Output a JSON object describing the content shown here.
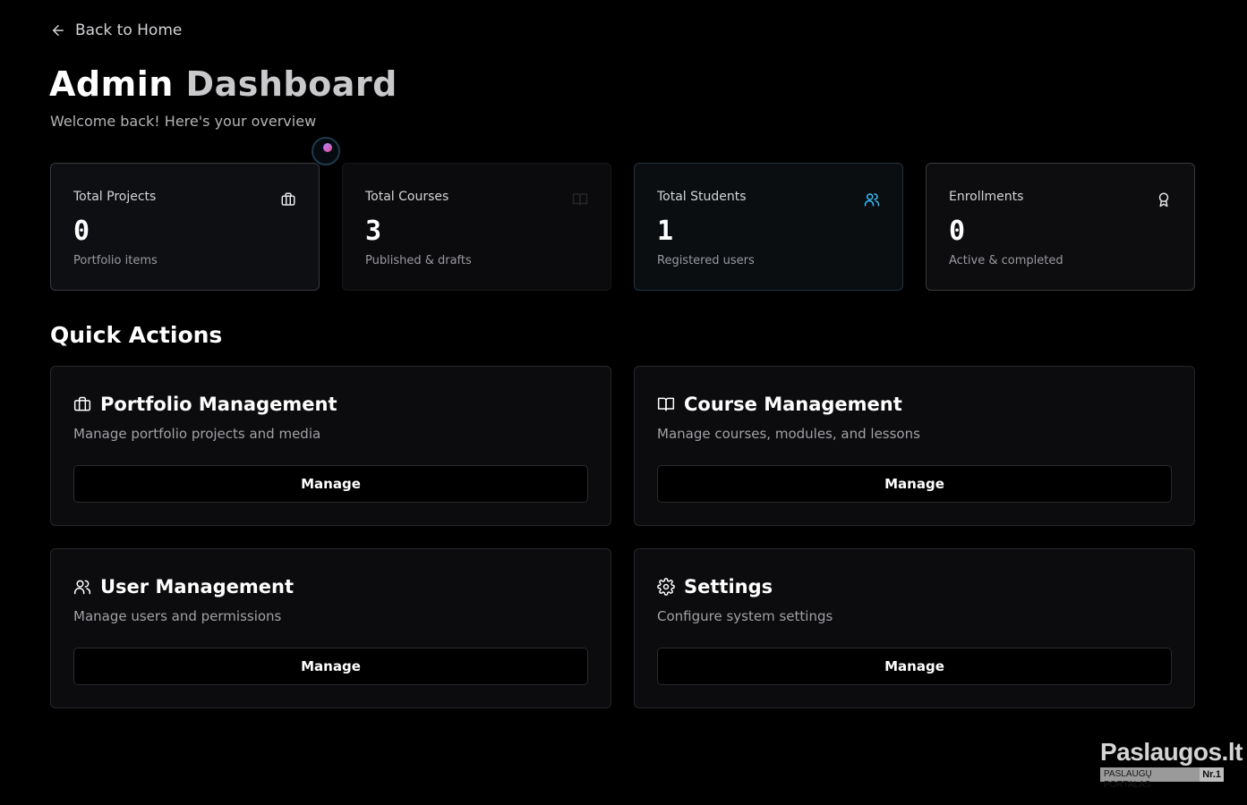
{
  "nav": {
    "back_label": "Back to Home"
  },
  "header": {
    "title_part1": "Admin",
    "title_part2": "Dashboard",
    "subtitle": "Welcome back! Here's your overview"
  },
  "stats": [
    {
      "label": "Total Projects",
      "value": "0",
      "desc": "Portfolio items",
      "icon": "briefcase-icon"
    },
    {
      "label": "Total Courses",
      "value": "3",
      "desc": "Published & drafts",
      "icon": "book-icon"
    },
    {
      "label": "Total Students",
      "value": "1",
      "desc": "Registered users",
      "icon": "users-icon"
    },
    {
      "label": "Enrollments",
      "value": "0",
      "desc": "Active & completed",
      "icon": "award-icon"
    }
  ],
  "quick_actions": {
    "title": "Quick Actions",
    "items": [
      {
        "title": "Portfolio Management",
        "desc": "Manage portfolio projects and media",
        "button": "Manage",
        "icon": "briefcase-icon"
      },
      {
        "title": "Course Management",
        "desc": "Manage courses, modules, and lessons",
        "button": "Manage",
        "icon": "book-icon"
      },
      {
        "title": "User Management",
        "desc": "Manage users and permissions",
        "button": "Manage",
        "icon": "users-icon"
      },
      {
        "title": "Settings",
        "desc": "Configure system settings",
        "button": "Manage",
        "icon": "gear-icon"
      }
    ]
  },
  "watermark": {
    "brand": "Paslaugos.lt",
    "tagline": "PASLAUGŲ PORTALAS",
    "rank": "Nr.1"
  },
  "colors": {
    "background": "#000000",
    "card": "#0c0c0e",
    "accent_cyan": "#38bdf8",
    "text_muted": "#a1a1a6"
  }
}
